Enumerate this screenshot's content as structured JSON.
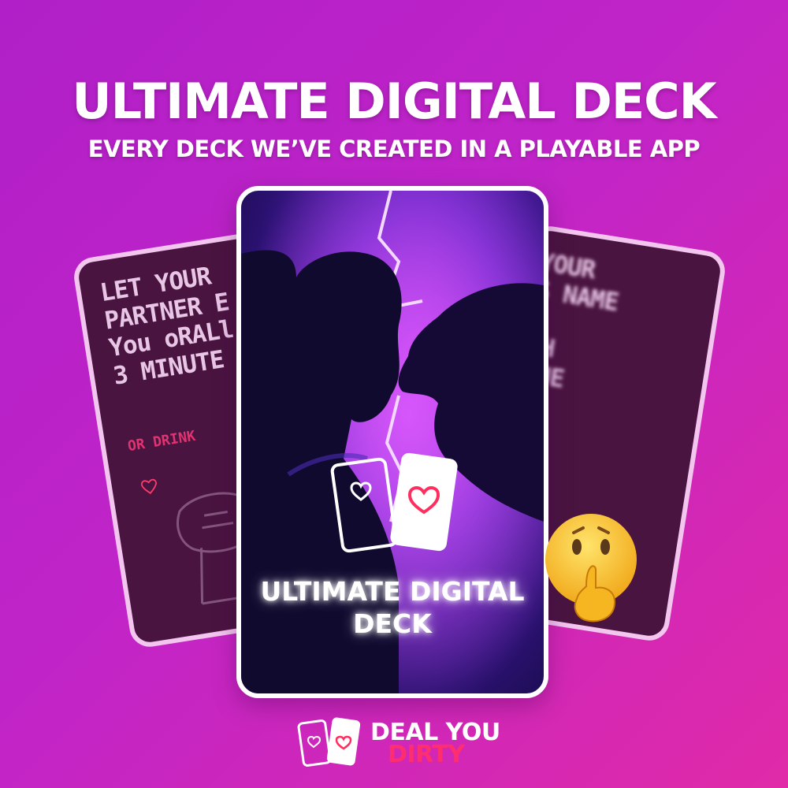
{
  "header": {
    "title": "ULTIMATE DIGITAL DECK",
    "subtitle": "EVERY DECK WE’VE CREATED IN A PLAYABLE APP"
  },
  "left_card": {
    "text": "LET YOUR\nPARTNER E\nYou oRALl\n3 MINUTE",
    "subtext": "OR DRINK"
  },
  "right_card": {
    "text": "YOUR\nS NAME\n\nTH\nGUE"
  },
  "main_card": {
    "title": "ULTIMATE DIGITAL\nDECK"
  },
  "brand": {
    "line1": "DEAL YOU",
    "line2": "DIRTY"
  },
  "colors": {
    "background_start": "#b01fc7",
    "background_end": "#e02aa8",
    "side_card": "#4a1440",
    "accent_red": "#ff2e6e"
  },
  "icons": [
    "heart-card-icon",
    "shushing-face-emoji"
  ]
}
